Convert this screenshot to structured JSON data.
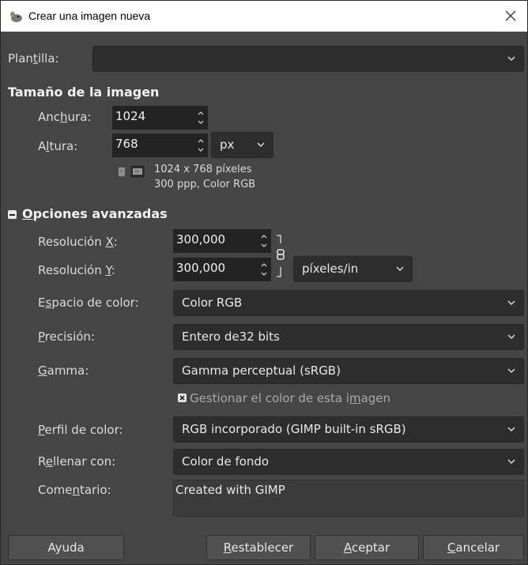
{
  "window": {
    "title": "Crear una imagen nueva"
  },
  "template": {
    "label_pre": "Plan",
    "label_mnemonic": "t",
    "label_post": "illa:",
    "value": ""
  },
  "image_size": {
    "header": "Tamaño de la imagen",
    "width": {
      "label_pre": "Anc",
      "label_mnemonic": "h",
      "label_post": "ura:",
      "value": "1024"
    },
    "height": {
      "label_pre": "A",
      "label_mnemonic": "l",
      "label_post": "tura:",
      "value": "768"
    },
    "unit": "px",
    "info_line1": "1024 x 768 píxeles",
    "info_line2": "300 ppp, Color RGB"
  },
  "advanced": {
    "toggle_symbol": "−",
    "header_mnemonic": "O",
    "header_rest": "pciones avanzadas",
    "res_x": {
      "label_pre": "Resolución ",
      "label_mnemonic": "X",
      "label_post": ":",
      "value": "300,000"
    },
    "res_y": {
      "label_pre": "Resolución ",
      "label_mnemonic": "Y",
      "label_post": ":",
      "value": "300,000"
    },
    "res_unit": "píxeles/in",
    "color_space": {
      "label_pre": "E",
      "label_mnemonic": "s",
      "label_post": "pacio de color:",
      "value": "Color RGB"
    },
    "precision": {
      "label_pre": "",
      "label_mnemonic": "P",
      "label_post": "recisión:",
      "value": "Entero de32 bits"
    },
    "gamma": {
      "label_pre": "",
      "label_mnemonic": "G",
      "label_post": "amma:",
      "value": "Gamma perceptual (sRGB)"
    },
    "manage_color": {
      "label_pre": "Gestionar el color de esta i",
      "label_mnemonic": "m",
      "label_post": "agen",
      "checked": true
    },
    "color_profile": {
      "label_pre": "",
      "label_mnemonic": "P",
      "label_post": "erfil de color:",
      "value": "RGB incorporado (GIMP built-in sRGB)"
    },
    "fill": {
      "label_pre": "R",
      "label_mnemonic": "e",
      "label_post": "llenar con:",
      "value": "Color de fondo"
    },
    "comment": {
      "label_pre": "Come",
      "label_mnemonic": "n",
      "label_post": "tario:",
      "value": "Created with GIMP"
    }
  },
  "buttons": {
    "help": "Ayuda",
    "reset_mnemonic": "R",
    "reset_rest": "establecer",
    "ok_mnemonic": "A",
    "ok_rest": "ceptar",
    "cancel_mnemonic": "C",
    "cancel_rest": "ancelar"
  }
}
